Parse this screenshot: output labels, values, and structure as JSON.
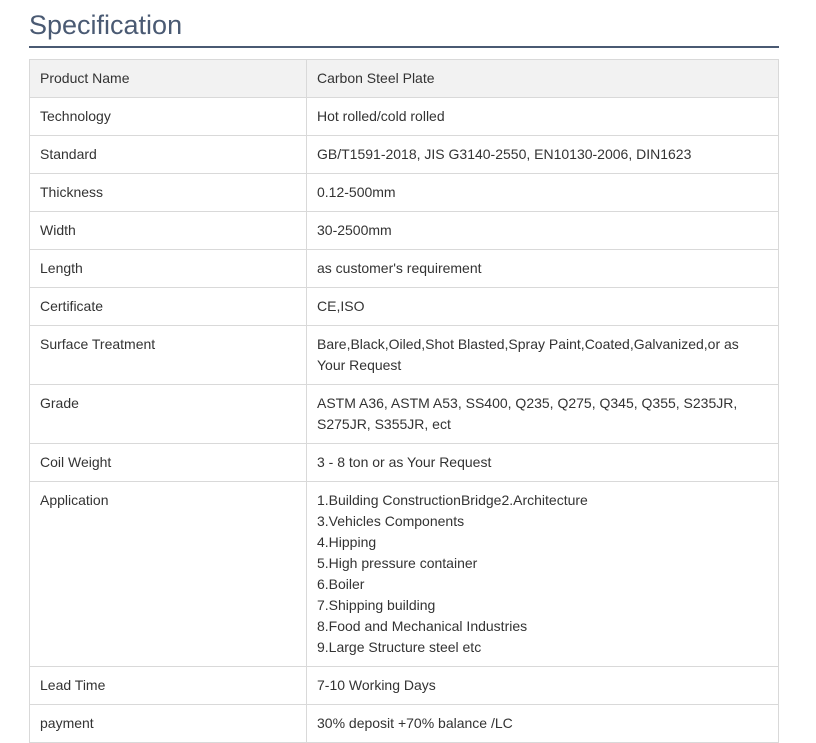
{
  "page": {
    "title": "Specification"
  },
  "table": {
    "rows": [
      {
        "label": "Product Name",
        "value": [
          "Carbon Steel Plate"
        ]
      },
      {
        "label": "Technology",
        "value": [
          "Hot rolled/cold rolled"
        ]
      },
      {
        "label": "Standard",
        "value": [
          "GB/T1591-2018, JIS G3140-2550, EN10130-2006, DIN1623"
        ]
      },
      {
        "label": "Thickness",
        "value": [
          "0.12-500mm"
        ]
      },
      {
        "label": "Width",
        "value": [
          "30-2500mm"
        ]
      },
      {
        "label": "Length",
        "value": [
          "as customer's requirement"
        ]
      },
      {
        "label": "Certificate",
        "value": [
          "CE,ISO"
        ]
      },
      {
        "label": "Surface Treatment",
        "value": [
          "Bare,Black,Oiled,Shot Blasted,Spray Paint,Coated,Galvanized,or as",
          "Your Request"
        ]
      },
      {
        "label": "Grade",
        "value": [
          "ASTM A36, ASTM A53, SS400, Q235, Q275, Q345, Q355, S235JR,",
          "S275JR, S355JR, ect"
        ]
      },
      {
        "label": "Coil Weight",
        "value": [
          "3 - 8 ton or as Your Request"
        ]
      },
      {
        "label": "Application",
        "value": [
          "1.Building ConstructionBridge2.Architecture",
          "3.Vehicles Components",
          "4.Hipping",
          "5.High pressure container",
          "6.Boiler",
          "7.Shipping building",
          "8.Food and Mechanical Industries",
          "9.Large Structure steel etc"
        ]
      },
      {
        "label": "Lead Time",
        "value": [
          "7-10 Working Days"
        ]
      },
      {
        "label": "payment",
        "value": [
          "30% deposit +70% balance /LC"
        ]
      }
    ]
  }
}
